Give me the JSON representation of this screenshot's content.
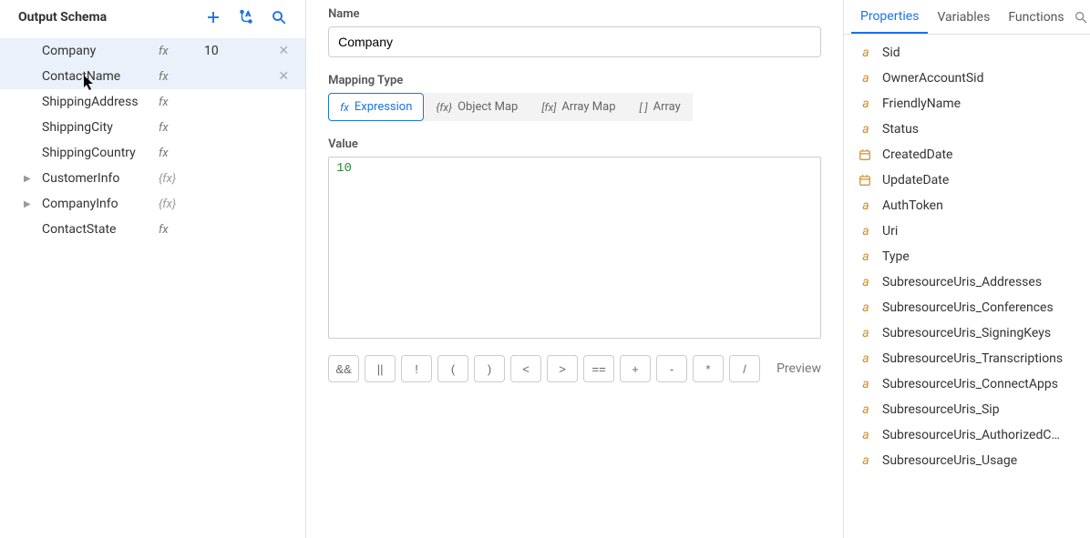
{
  "left": {
    "title": "Output Schema",
    "items": [
      {
        "name": "Company",
        "fx": "fx",
        "value": "10",
        "selected": true,
        "closable": true,
        "expandable": false
      },
      {
        "name": "ContactName",
        "fx": "fx",
        "value": "",
        "selected": true,
        "closable": true,
        "expandable": false
      },
      {
        "name": "ShippingAddress",
        "fx": "fx",
        "value": "",
        "selected": false,
        "closable": false,
        "expandable": false
      },
      {
        "name": "ShippingCity",
        "fx": "fx",
        "value": "",
        "selected": false,
        "closable": false,
        "expandable": false
      },
      {
        "name": "ShippingCountry",
        "fx": "fx",
        "value": "",
        "selected": false,
        "closable": false,
        "expandable": false
      },
      {
        "name": "CustomerInfo",
        "fx": "{fx}",
        "value": "",
        "selected": false,
        "closable": false,
        "expandable": true
      },
      {
        "name": "CompanyInfo",
        "fx": "{fx}",
        "value": "",
        "selected": false,
        "closable": false,
        "expandable": true
      },
      {
        "name": "ContactState",
        "fx": "fx",
        "value": "",
        "selected": false,
        "closable": false,
        "expandable": false
      }
    ]
  },
  "form": {
    "name_label": "Name",
    "name_value": "Company",
    "mapping_label": "Mapping Type",
    "mapping_types": [
      {
        "icon": "fx",
        "label": "Expression",
        "active": true
      },
      {
        "icon": "{fx}",
        "label": "Object Map",
        "active": false
      },
      {
        "icon": "[fx]",
        "label": "Array Map",
        "active": false
      },
      {
        "icon": "[ ]",
        "label": "Array",
        "active": false
      }
    ],
    "value_label": "Value",
    "value_text": "10",
    "operators": [
      "&&",
      "||",
      "!",
      "(",
      ")",
      "<",
      ">",
      "==",
      "+",
      "-",
      "*",
      "/"
    ],
    "preview": "Preview"
  },
  "right": {
    "tabs": [
      {
        "label": "Properties",
        "active": true
      },
      {
        "label": "Variables",
        "active": false
      },
      {
        "label": "Functions",
        "active": false
      }
    ],
    "properties": [
      {
        "name": "Sid",
        "icon": "a"
      },
      {
        "name": "OwnerAccountSid",
        "icon": "a"
      },
      {
        "name": "FriendlyName",
        "icon": "a"
      },
      {
        "name": "Status",
        "icon": "a"
      },
      {
        "name": "CreatedDate",
        "icon": "date"
      },
      {
        "name": "UpdateDate",
        "icon": "date"
      },
      {
        "name": "AuthToken",
        "icon": "a"
      },
      {
        "name": "Uri",
        "icon": "a"
      },
      {
        "name": "Type",
        "icon": "a"
      },
      {
        "name": "SubresourceUris_Addresses",
        "icon": "a"
      },
      {
        "name": "SubresourceUris_Conferences",
        "icon": "a"
      },
      {
        "name": "SubresourceUris_SigningKeys",
        "icon": "a"
      },
      {
        "name": "SubresourceUris_Transcriptions",
        "icon": "a"
      },
      {
        "name": "SubresourceUris_ConnectApps",
        "icon": "a"
      },
      {
        "name": "SubresourceUris_Sip",
        "icon": "a"
      },
      {
        "name": "SubresourceUris_AuthorizedC…",
        "icon": "a"
      },
      {
        "name": "SubresourceUris_Usage",
        "icon": "a"
      }
    ]
  }
}
